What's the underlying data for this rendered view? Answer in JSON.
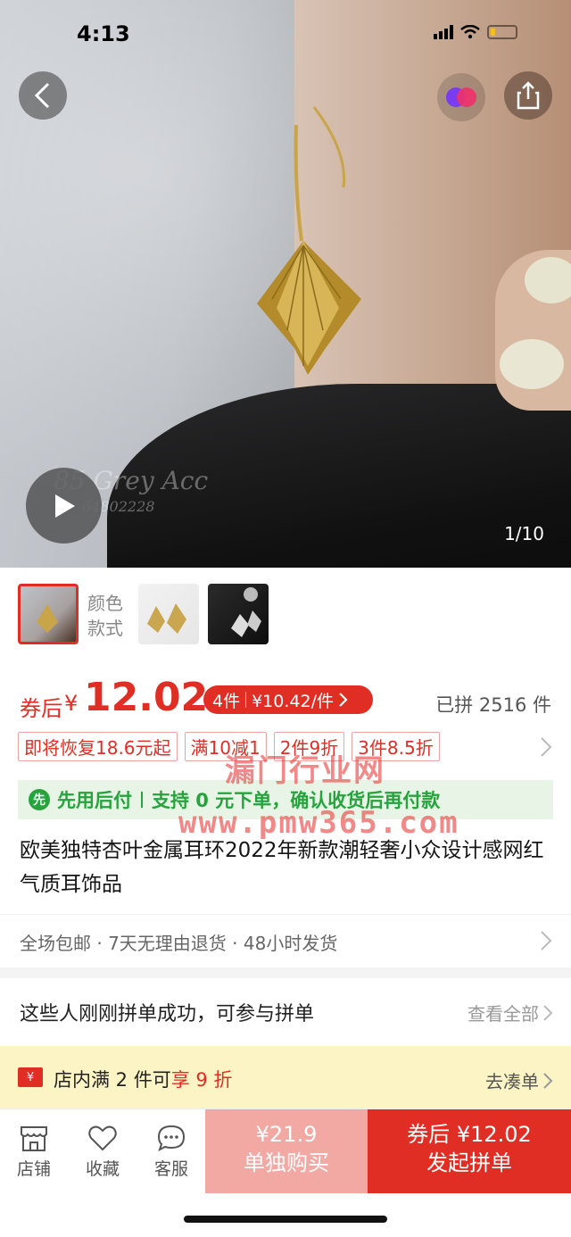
{
  "status_bar": {
    "time": "4:13"
  },
  "gallery": {
    "counter": "1/10",
    "watermark_line1": "85 Grey Acc",
    "watermark_line2": "64802228"
  },
  "variants": {
    "label_line1": "颜色",
    "label_line2": "款式"
  },
  "price": {
    "coupon_prefix": "券后",
    "currency": "¥",
    "amount": "12.02",
    "group_pill_qty": "4件",
    "group_pill_price": "¥10.42/件",
    "sold_count": "已拼 2516 件"
  },
  "promo_tags": [
    "即将恢复18.6元起",
    "满10减1",
    "2件9折",
    "3件8.5折"
  ],
  "pay_later": {
    "badge": "先",
    "title": "先用后付",
    "desc": "支持 0 元下单，确认收货后再付款"
  },
  "product_title": "欧美独特杏叶金属耳环2022年新款潮轻奢小众设计感网红气质耳饰品",
  "service": "全场包邮 · 7天无理由退货 · 48小时发货",
  "group_buy": {
    "text": "这些人刚刚拼单成功，可参与拼单",
    "more": "查看全部"
  },
  "store_promo": {
    "icon_text": "¥",
    "text_prefix": "店内满 2 件可",
    "text_highlight": "享 9 折",
    "go": "去凑单"
  },
  "bottom_bar": {
    "store": "店铺",
    "favorite": "收藏",
    "service": "客服",
    "single_price": "¥21.9",
    "single_label": "单独购买",
    "group_price": "券后 ¥12.02",
    "group_label": "发起拼单"
  },
  "overlay_watermark": {
    "line1": "漏门行业网",
    "line2": "www.pmw365.com"
  },
  "colors": {
    "accent_red": "#e02e24",
    "pay_green": "#26a33c",
    "promo_yellow": "#fdf4c6",
    "single_btn": "#f2a9a4"
  }
}
